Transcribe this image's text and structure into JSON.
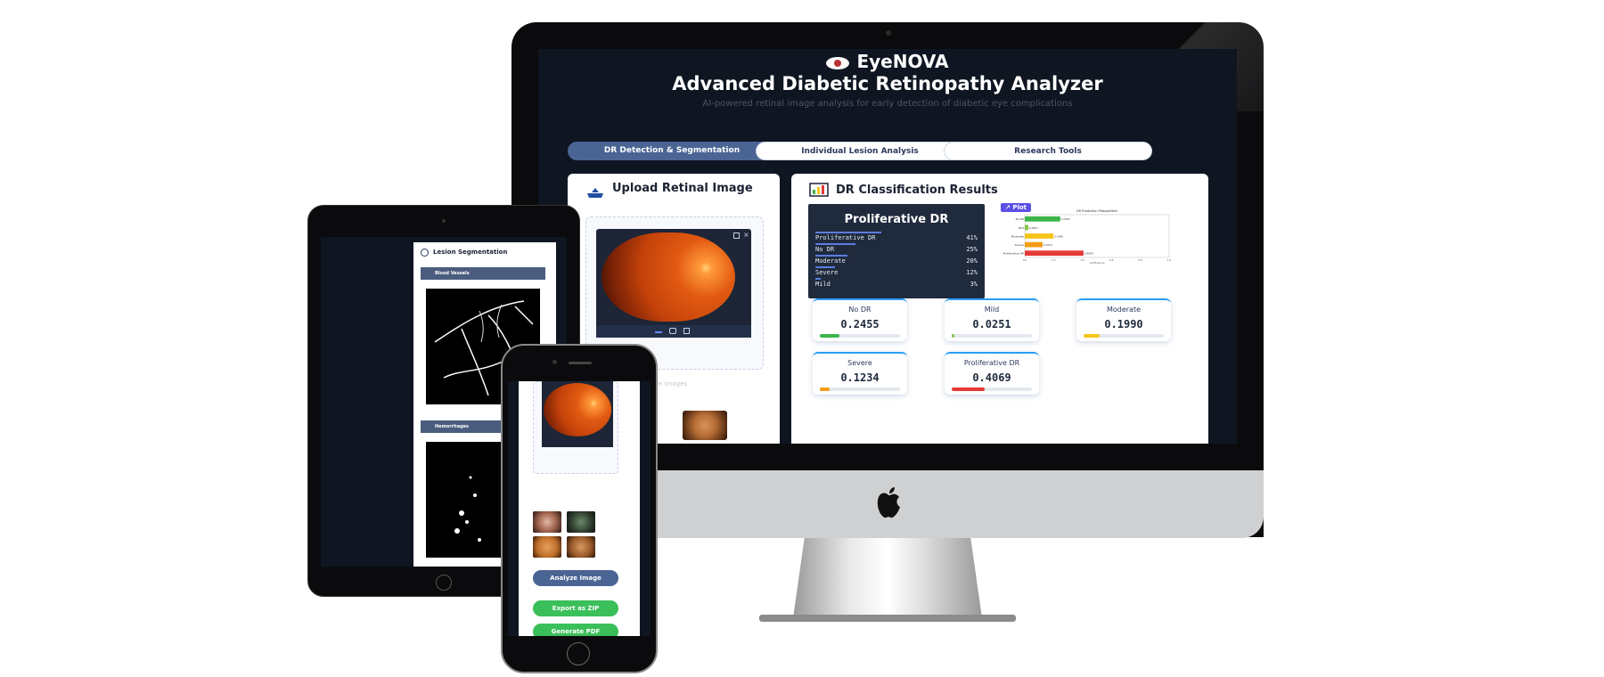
{
  "app": {
    "name": "EyeNOVA",
    "subtitle": "Advanced Diabetic Retinopathy Analyzer",
    "description": "AI-powered retinal image analysis for early detection of diabetic eye complications"
  },
  "tabs": [
    {
      "label": "DR Detection & Segmentation",
      "active": true
    },
    {
      "label": "Individual Lesion Analysis",
      "active": false
    },
    {
      "label": "Research Tools",
      "active": false
    }
  ],
  "upload": {
    "title": "Upload Retinal Image",
    "icon": "upload-tray-icon",
    "examples_label": "Example images"
  },
  "results": {
    "title": "DR Classification Results",
    "icon": "bar-chart-icon",
    "predicted_label": "Proliferative DR",
    "confidences": [
      {
        "label": "Proliferative DR",
        "pct": "41%",
        "value": 0.41
      },
      {
        "label": "No DR",
        "pct": "25%",
        "value": 0.25
      },
      {
        "label": "Moderate",
        "pct": "20%",
        "value": 0.2
      },
      {
        "label": "Severe",
        "pct": "12%",
        "value": 0.12
      },
      {
        "label": "Mild",
        "pct": "3%",
        "value": 0.03
      }
    ],
    "plot_tag": "Plot",
    "metrics": [
      {
        "label": "No DR",
        "value": "0.2455",
        "fraction": 0.2455,
        "color": "#3bb54a"
      },
      {
        "label": "Mild",
        "value": "0.0251",
        "fraction": 0.0251,
        "color": "#8bc34a"
      },
      {
        "label": "Moderate",
        "value": "0.1990",
        "fraction": 0.199,
        "color": "#f5c518"
      },
      {
        "label": "Severe",
        "value": "0.1234",
        "fraction": 0.1234,
        "color": "#f39c12"
      },
      {
        "label": "Proliferative DR",
        "value": "0.4069",
        "fraction": 0.4069,
        "color": "#e53935"
      }
    ]
  },
  "chart_data": {
    "type": "bar",
    "title": "DR Prediction Probabilities",
    "xlabel": "Confidence",
    "ylabel": "",
    "categories": [
      "No DR",
      "Mild",
      "Moderate",
      "Severe",
      "Proliferative DR"
    ],
    "values": [
      0.2455,
      0.0251,
      0.199,
      0.1234,
      0.4069
    ],
    "colors": [
      "#3bb54a",
      "#8bc34a",
      "#f5c518",
      "#f39c12",
      "#e53935"
    ],
    "xlim": [
      0,
      1.0
    ],
    "orientation": "horizontal"
  },
  "tablet": {
    "card_title": "Lesion Segmentation",
    "sections": [
      {
        "label": "Blood Vessels"
      },
      {
        "label": "Hemorrhages"
      }
    ]
  },
  "phone": {
    "analyze_label": "Analyze Image",
    "export_label": "Export as ZIP",
    "pdf_label": "Generate PDF",
    "colors": {
      "analyze": "#4a6494",
      "export": "#3bbf5a",
      "pdf": "#3bbf5a"
    }
  }
}
